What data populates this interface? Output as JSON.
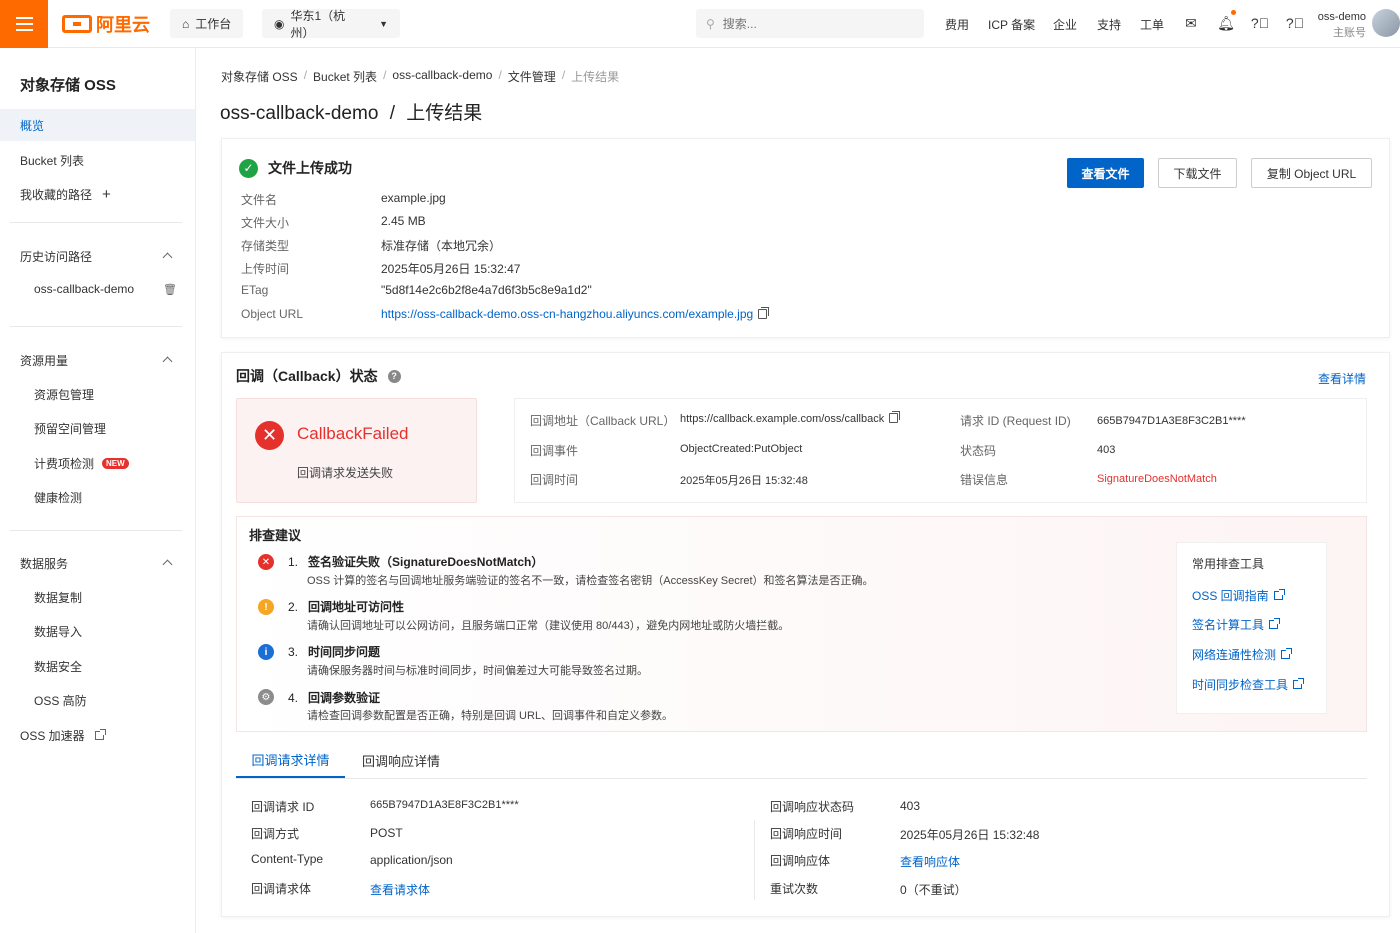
{
  "header": {
    "brand": "阿里云",
    "workbench": "工作台",
    "region": "华东1（杭州）",
    "search_placeholder": "搜索...",
    "nav": [
      "费用",
      "ICP 备案",
      "企业",
      "支持",
      "工单"
    ],
    "user_name": "oss-demo",
    "user_role": "主账号"
  },
  "sidebar": {
    "title": "对象存储 OSS",
    "overview": "概览",
    "bucket_list": "Bucket 列表",
    "favorites": "我收藏的路径",
    "history_title": "历史访问路径",
    "history_item": "oss-callback-demo",
    "usage_title": "资源用量",
    "usage_items": [
      "资源包管理",
      "预留空间管理",
      "计费项检测",
      "健康检测"
    ],
    "new_badge": "NEW",
    "data_title": "数据服务",
    "data_items": [
      "数据复制",
      "数据导入",
      "数据安全",
      "OSS 高防"
    ],
    "accelerator": "OSS 加速器"
  },
  "breadcrumb": [
    "对象存储 OSS",
    "Bucket 列表",
    "oss-callback-demo",
    "文件管理",
    "上传结果"
  ],
  "page_title": {
    "bucket": "oss-callback-demo",
    "sep": "/",
    "page": "上传结果"
  },
  "upload": {
    "status": "文件上传成功",
    "buttons": {
      "view": "查看文件",
      "download": "下载文件",
      "copy_url": "复制 Object URL"
    },
    "fields": [
      {
        "label": "文件名",
        "value": "example.jpg"
      },
      {
        "label": "文件大小",
        "value": "2.45 MB"
      },
      {
        "label": "存储类型",
        "value": "标准存储（本地冗余）"
      },
      {
        "label": "上传时间",
        "value": "2025年05月26日 15:32:47"
      },
      {
        "label": "ETag",
        "value": "\"5d8f14e2c6b2f8e4a7d6f3b5c8e9a1d2\""
      },
      {
        "label": "Object URL",
        "value": "https://oss-callback-demo.oss-cn-hangzhou.aliyuncs.com/example.jpg"
      }
    ]
  },
  "callback": {
    "title": "回调（Callback）状态",
    "view_details": "查看详情",
    "fail_title": "CallbackFailed",
    "fail_sub": "回调请求发送失败",
    "left": [
      {
        "label": "回调地址（Callback URL）",
        "value": "https://callback.example.com/oss/callback"
      },
      {
        "label": "回调事件",
        "value": "ObjectCreated:PutObject"
      },
      {
        "label": "回调时间",
        "value": "2025年05月26日 15:32:48"
      }
    ],
    "right": [
      {
        "label": "请求 ID (Request ID)",
        "value": "665B7947D1A3E8F3C2B1****"
      },
      {
        "label": "状态码",
        "value": "403"
      },
      {
        "label": "错误信息",
        "value": "SignatureDoesNotMatch"
      }
    ],
    "error_color": "#e5312c"
  },
  "advice": {
    "title": "排查建议",
    "items": [
      {
        "num": "1.",
        "title": "签名验证失败（SignatureDoesNotMatch）",
        "desc": "OSS 计算的签名与回调地址服务端验证的签名不一致，请检查签名密钥（AccessKey Secret）和签名算法是否正确。",
        "icon": "error-icon",
        "color": "#e5312c"
      },
      {
        "num": "2.",
        "title": "回调地址可访问性",
        "desc": "请确认回调地址可以公网访问，且服务端口正常（建议使用 80/443），避免内网地址或防火墙拦截。",
        "icon": "warning-icon",
        "color": "#f5a623"
      },
      {
        "num": "3.",
        "title": "时间同步问题",
        "desc": "请确保服务器时间与标准时间同步，时间偏差过大可能导致签名过期。",
        "icon": "info-icon",
        "color": "#1a6fd6"
      },
      {
        "num": "4.",
        "title": "回调参数验证",
        "desc": "请检查回调参数配置是否正确，特别是回调 URL、回调事件和自定义参数。",
        "icon": "gear-icon",
        "color": "#8c8c8c"
      }
    ],
    "tools_title": "常用排查工具",
    "tools": [
      "OSS 回调指南",
      "签名计算工具",
      "网络连通性检测",
      "时间同步检查工具"
    ]
  },
  "tabs": [
    "回调请求详情",
    "回调响应详情"
  ],
  "request": {
    "left": [
      {
        "label": "回调请求 ID",
        "value": "665B7947D1A3E8F3C2B1****"
      },
      {
        "label": "回调方式",
        "value": "POST"
      },
      {
        "label": "Content-Type",
        "value": "application/json"
      },
      {
        "label": "回调请求体",
        "value": "查看请求体",
        "link": true
      }
    ],
    "right": [
      {
        "label": "回调响应状态码",
        "value": "403"
      },
      {
        "label": "回调响应时间",
        "value": "2025年05月26日 15:32:48"
      },
      {
        "label": "回调响应体",
        "value": "查看响应体",
        "link": true
      },
      {
        "label": "重试次数",
        "value": "0（不重试）"
      }
    ]
  }
}
